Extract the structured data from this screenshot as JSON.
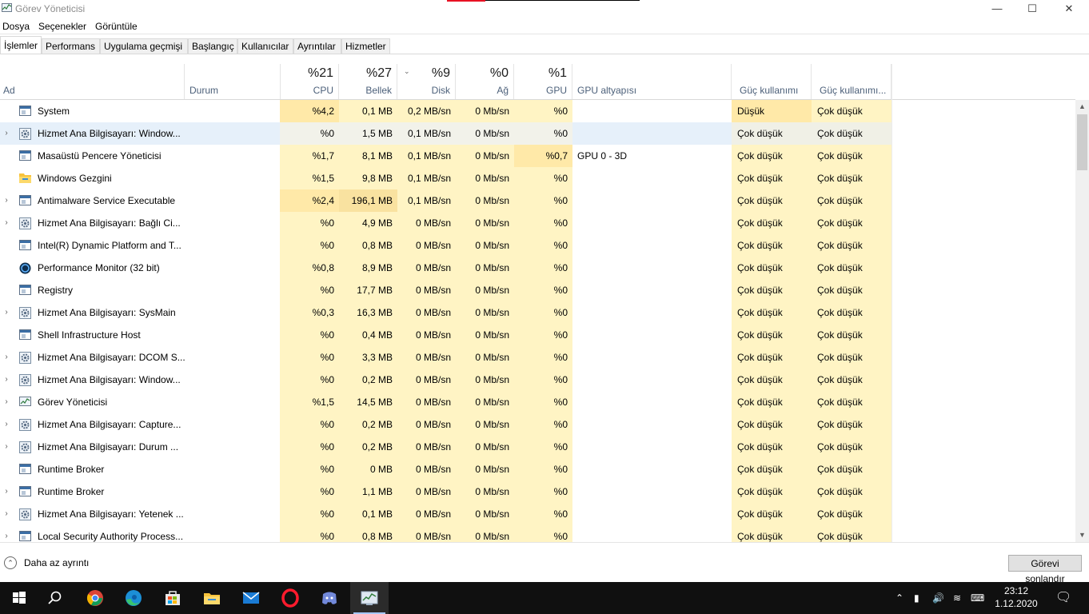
{
  "window": {
    "title": "Görev Yöneticisi",
    "min": "—",
    "max": "☐",
    "close": "✕"
  },
  "menu": [
    "Dosya",
    "Seçenekler",
    "Görüntüle"
  ],
  "tabs": [
    "İşlemler",
    "Performans",
    "Uygulama geçmişi",
    "Başlangıç",
    "Kullanıcılar",
    "Ayrıntılar",
    "Hizmetler"
  ],
  "columns": {
    "name": "Ad",
    "status": "Durum",
    "cpu": {
      "pct": "%21",
      "label": "CPU"
    },
    "mem": {
      "pct": "%27",
      "label": "Bellek"
    },
    "disk": {
      "pct": "%9",
      "label": "Disk"
    },
    "net": {
      "pct": "%0",
      "label": "Ağ"
    },
    "gpu": {
      "pct": "%1",
      "label": "GPU"
    },
    "gpu_engine": "GPU altyapısı",
    "power": "Güç kullanımı",
    "power_trend": "Güç kullanımı..."
  },
  "rows": [
    {
      "expand": false,
      "icon": "window-icon",
      "name": "System",
      "cpu": "%4,2",
      "mem": "0,1 MB",
      "disk": "0,2 MB/sn",
      "net": "0 Mb/sn",
      "gpu": "%0",
      "engine": "",
      "power": "Düşük",
      "power_trend": "Çok düşük",
      "selected": false
    },
    {
      "expand": true,
      "icon": "gear-icon",
      "name": "Hizmet Ana Bilgisayarı: Window...",
      "cpu": "%0",
      "mem": "1,5 MB",
      "disk": "0,1 MB/sn",
      "net": "0 Mb/sn",
      "gpu": "%0",
      "engine": "",
      "power": "Çok düşük",
      "power_trend": "Çok düşük",
      "selected": true
    },
    {
      "expand": false,
      "icon": "window-icon",
      "name": "Masaüstü Pencere Yöneticisi",
      "cpu": "%1,7",
      "mem": "8,1 MB",
      "disk": "0,1 MB/sn",
      "net": "0 Mb/sn",
      "gpu": "%0,7",
      "engine": "GPU 0 - 3D",
      "power": "Çok düşük",
      "power_trend": "Çok düşük",
      "selected": false
    },
    {
      "expand": false,
      "icon": "folder-icon",
      "name": "Windows Gezgini",
      "cpu": "%1,5",
      "mem": "9,8 MB",
      "disk": "0,1 MB/sn",
      "net": "0 Mb/sn",
      "gpu": "%0",
      "engine": "",
      "power": "Çok düşük",
      "power_trend": "Çok düşük",
      "selected": false
    },
    {
      "expand": true,
      "icon": "window-icon",
      "name": "Antimalware Service Executable",
      "cpu": "%2,4",
      "mem": "196,1 MB",
      "disk": "0,1 MB/sn",
      "net": "0 Mb/sn",
      "gpu": "%0",
      "engine": "",
      "power": "Çok düşük",
      "power_trend": "Çok düşük",
      "selected": false
    },
    {
      "expand": true,
      "icon": "gear-icon",
      "name": "Hizmet Ana Bilgisayarı: Bağlı Ci...",
      "cpu": "%0",
      "mem": "4,9 MB",
      "disk": "0 MB/sn",
      "net": "0 Mb/sn",
      "gpu": "%0",
      "engine": "",
      "power": "Çok düşük",
      "power_trend": "Çok düşük",
      "selected": false
    },
    {
      "expand": false,
      "icon": "window-icon",
      "name": "Intel(R) Dynamic Platform and T...",
      "cpu": "%0",
      "mem": "0,8 MB",
      "disk": "0 MB/sn",
      "net": "0 Mb/sn",
      "gpu": "%0",
      "engine": "",
      "power": "Çok düşük",
      "power_trend": "Çok düşük",
      "selected": false
    },
    {
      "expand": false,
      "icon": "perf-monitor-icon",
      "name": "Performance Monitor (32 bit)",
      "cpu": "%0,8",
      "mem": "8,9 MB",
      "disk": "0 MB/sn",
      "net": "0 Mb/sn",
      "gpu": "%0",
      "engine": "",
      "power": "Çok düşük",
      "power_trend": "Çok düşük",
      "selected": false
    },
    {
      "expand": false,
      "icon": "window-icon",
      "name": "Registry",
      "cpu": "%0",
      "mem": "17,7 MB",
      "disk": "0 MB/sn",
      "net": "0 Mb/sn",
      "gpu": "%0",
      "engine": "",
      "power": "Çok düşük",
      "power_trend": "Çok düşük",
      "selected": false
    },
    {
      "expand": true,
      "icon": "gear-icon",
      "name": "Hizmet Ana Bilgisayarı: SysMain",
      "cpu": "%0,3",
      "mem": "16,3 MB",
      "disk": "0 MB/sn",
      "net": "0 Mb/sn",
      "gpu": "%0",
      "engine": "",
      "power": "Çok düşük",
      "power_trend": "Çok düşük",
      "selected": false
    },
    {
      "expand": false,
      "icon": "window-icon",
      "name": "Shell Infrastructure Host",
      "cpu": "%0",
      "mem": "0,4 MB",
      "disk": "0 MB/sn",
      "net": "0 Mb/sn",
      "gpu": "%0",
      "engine": "",
      "power": "Çok düşük",
      "power_trend": "Çok düşük",
      "selected": false
    },
    {
      "expand": true,
      "icon": "gear-icon",
      "name": "Hizmet Ana Bilgisayarı: DCOM S...",
      "cpu": "%0",
      "mem": "3,3 MB",
      "disk": "0 MB/sn",
      "net": "0 Mb/sn",
      "gpu": "%0",
      "engine": "",
      "power": "Çok düşük",
      "power_trend": "Çok düşük",
      "selected": false
    },
    {
      "expand": true,
      "icon": "gear-icon",
      "name": "Hizmet Ana Bilgisayarı: Window...",
      "cpu": "%0",
      "mem": "0,2 MB",
      "disk": "0 MB/sn",
      "net": "0 Mb/sn",
      "gpu": "%0",
      "engine": "",
      "power": "Çok düşük",
      "power_trend": "Çok düşük",
      "selected": false
    },
    {
      "expand": true,
      "icon": "task-manager-icon",
      "name": "Görev Yöneticisi",
      "cpu": "%1,5",
      "mem": "14,5 MB",
      "disk": "0 MB/sn",
      "net": "0 Mb/sn",
      "gpu": "%0",
      "engine": "",
      "power": "Çok düşük",
      "power_trend": "Çok düşük",
      "selected": false
    },
    {
      "expand": true,
      "icon": "gear-icon",
      "name": "Hizmet Ana Bilgisayarı: Capture...",
      "cpu": "%0",
      "mem": "0,2 MB",
      "disk": "0 MB/sn",
      "net": "0 Mb/sn",
      "gpu": "%0",
      "engine": "",
      "power": "Çok düşük",
      "power_trend": "Çok düşük",
      "selected": false
    },
    {
      "expand": true,
      "icon": "gear-icon",
      "name": "Hizmet Ana Bilgisayarı: Durum ...",
      "cpu": "%0",
      "mem": "0,2 MB",
      "disk": "0 MB/sn",
      "net": "0 Mb/sn",
      "gpu": "%0",
      "engine": "",
      "power": "Çok düşük",
      "power_trend": "Çok düşük",
      "selected": false
    },
    {
      "expand": false,
      "icon": "window-icon",
      "name": "Runtime Broker",
      "cpu": "%0",
      "mem": "0 MB",
      "disk": "0 MB/sn",
      "net": "0 Mb/sn",
      "gpu": "%0",
      "engine": "",
      "power": "Çok düşük",
      "power_trend": "Çok düşük",
      "selected": false
    },
    {
      "expand": true,
      "icon": "window-icon",
      "name": "Runtime Broker",
      "cpu": "%0",
      "mem": "1,1 MB",
      "disk": "0 MB/sn",
      "net": "0 Mb/sn",
      "gpu": "%0",
      "engine": "",
      "power": "Çok düşük",
      "power_trend": "Çok düşük",
      "selected": false
    },
    {
      "expand": true,
      "icon": "gear-icon",
      "name": "Hizmet Ana Bilgisayarı: Yetenek ...",
      "cpu": "%0",
      "mem": "0,1 MB",
      "disk": "0 MB/sn",
      "net": "0 Mb/sn",
      "gpu": "%0",
      "engine": "",
      "power": "Çok düşük",
      "power_trend": "Çok düşük",
      "selected": false
    },
    {
      "expand": true,
      "icon": "window-icon",
      "name": "Local Security Authority Process...",
      "cpu": "%0",
      "mem": "0,8 MB",
      "disk": "0 MB/sn",
      "net": "0 Mb/sn",
      "gpu": "%0",
      "engine": "",
      "power": "Çok düşük",
      "power_trend": "Çok düşük",
      "selected": false
    }
  ],
  "footer": {
    "fewer_details": "Daha az ayrıntı",
    "end_task": "Görevi sonlandır"
  },
  "taskbar": {
    "apps": [
      "windows-start-icon",
      "search-icon",
      "chrome-icon",
      "edge-icon",
      "store-icon",
      "file-explorer-icon",
      "mail-icon",
      "opera-icon",
      "discord-icon",
      "task-manager-icon"
    ],
    "time": "23:12",
    "date": "1.12.2020"
  },
  "colors": {
    "heat_light": "#fff4c4",
    "heat_mid": "#ffe9a8",
    "selected_row": "#e6f0fa",
    "header_label": "#4c607a",
    "taskbar": "#101010"
  }
}
